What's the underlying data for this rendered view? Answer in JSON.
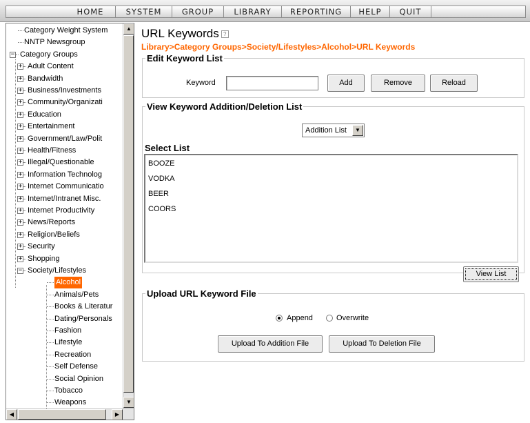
{
  "menu": {
    "items": [
      {
        "label": "HOME"
      },
      {
        "label": "SYSTEM"
      },
      {
        "label": "GROUP"
      },
      {
        "label": "LIBRARY"
      },
      {
        "label": "REPORTING"
      },
      {
        "label": "HELP"
      },
      {
        "label": "QUIT"
      }
    ]
  },
  "tree": {
    "top_items": [
      "Category Weight System",
      "NNTP Newsgroup"
    ],
    "root_label": "Category Groups",
    "groups": [
      "Adult Content",
      "Bandwidth",
      "Business/Investments",
      "Community/Organizati",
      "Education",
      "Entertainment",
      "Government/Law/Polit",
      "Health/Fitness",
      "Illegal/Questionable",
      "Information Technolog",
      "Internet Communicatio",
      "Internet/Intranet Misc.",
      "Internet Productivity",
      "News/Reports",
      "Religion/Beliefs",
      "Security",
      "Shopping"
    ],
    "expanded_group": "Society/Lifestyles",
    "children": [
      "Alcohol",
      "Animals/Pets",
      "Books & Literatur",
      "Dating/Personals",
      "Fashion",
      "Lifestyle",
      "Recreation",
      "Self Defense",
      "Social Opinion",
      "Tobacco",
      "Weapons"
    ],
    "selected": "Alcohol"
  },
  "page": {
    "title": "URL Keywords",
    "breadcrumb": "Library>Category Groups>Society/Lifestyles>Alcohol>URL Keywords"
  },
  "edit_section": {
    "legend": "Edit Keyword List",
    "keyword_label": "Keyword",
    "keyword_value": "",
    "add_label": "Add",
    "remove_label": "Remove",
    "reload_label": "Reload"
  },
  "view_section": {
    "legend": "View Keyword Addition/Deletion List",
    "list_type_selected": "Addition List",
    "select_list_label": "Select List",
    "keywords": [
      "BOOZE",
      "VODKA",
      "BEER",
      "COORS"
    ],
    "view_list_label": "View List"
  },
  "upload_section": {
    "legend": "Upload URL Keyword File",
    "append_label": "Append",
    "overwrite_label": "Overwrite",
    "append_checked": true,
    "upload_addition_label": "Upload To Addition File",
    "upload_deletion_label": "Upload To Deletion File"
  }
}
